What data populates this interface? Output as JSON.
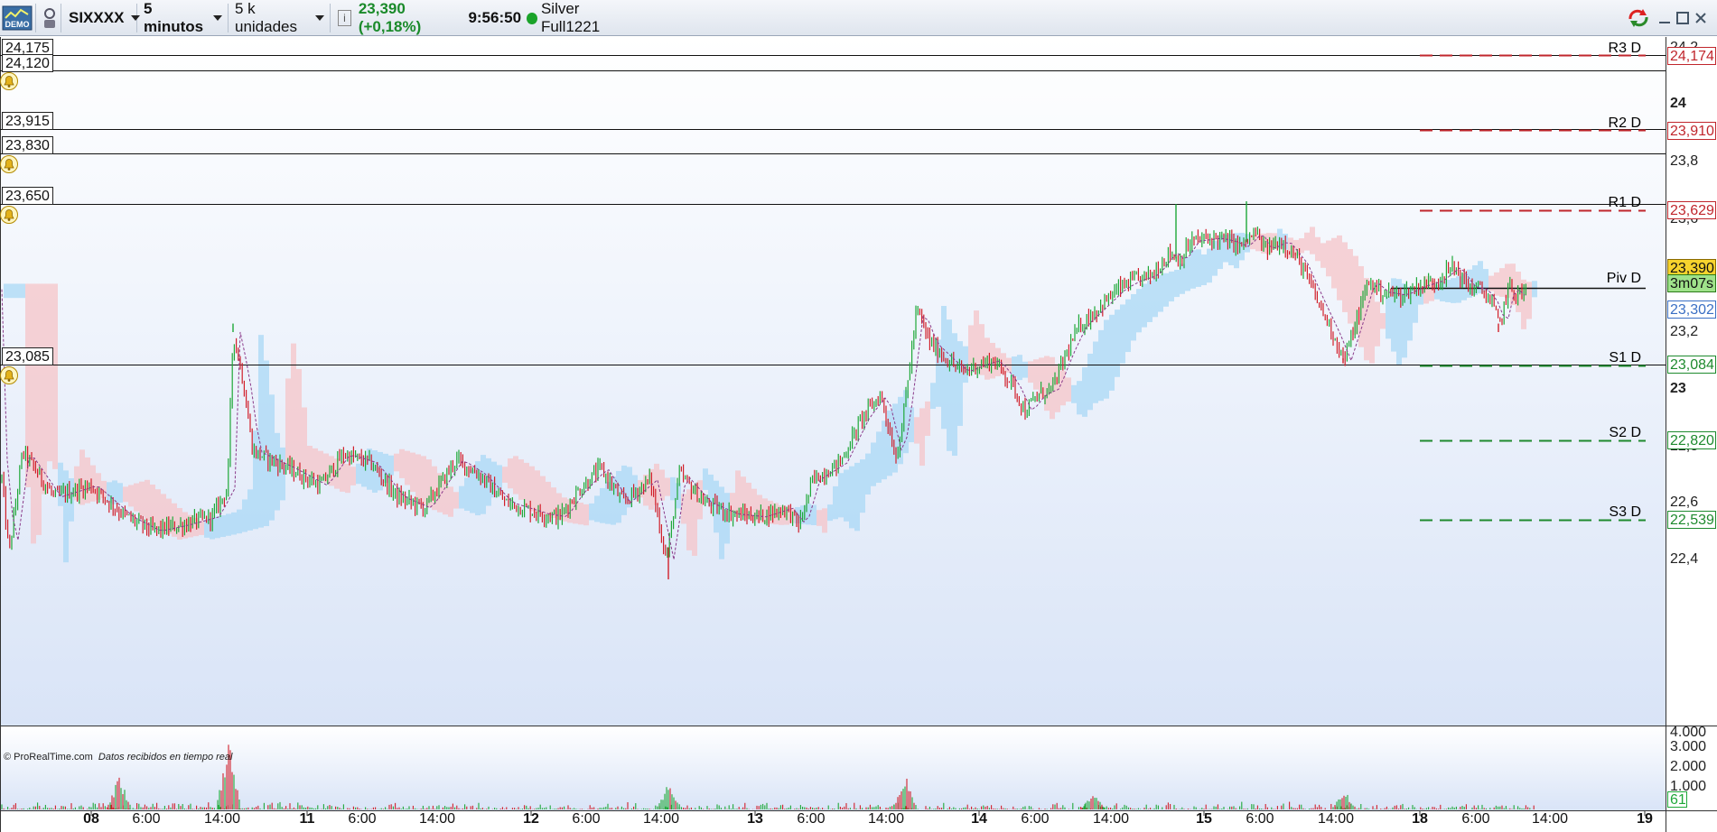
{
  "toolbar": {
    "demo_badge": "DEMO",
    "symbol": "SIXXXX",
    "timeframe": "5 minutos",
    "units": "5 k unidades",
    "quote": "23,390 (+0,18%)",
    "time": "9:56:50",
    "account": "Silver Full1221"
  },
  "alerts": [
    {
      "label": "24,175"
    },
    {
      "label": "24,120"
    },
    {
      "label": "23,915"
    },
    {
      "label": "23,830"
    },
    {
      "label": "23,650"
    },
    {
      "label": "23,085"
    }
  ],
  "pivots": [
    {
      "name": "R3 D",
      "value": "24,174",
      "color": "#c0262c"
    },
    {
      "name": "R2 D",
      "value": "23,910",
      "color": "#c0262c"
    },
    {
      "name": "R1 D",
      "value": "23,629",
      "color": "#c0262c"
    },
    {
      "name": "Piv D",
      "value": "3m07s",
      "color": "#111111"
    },
    {
      "name": "S1 D",
      "value": "23,084",
      "color": "#1e8a2e"
    },
    {
      "name": "S2 D",
      "value": "22,820",
      "color": "#1e8a2e"
    },
    {
      "name": "S3 D",
      "value": "22,539",
      "color": "#1e8a2e"
    }
  ],
  "price_tags": {
    "last": "23,390",
    "countdown": "3m07s",
    "ref": "23,302",
    "volume_last": "61"
  },
  "y_axis": [
    "24,2",
    "24",
    "23,8",
    "23,6",
    "23,2",
    "23",
    "22,8",
    "22,6",
    "22,4"
  ],
  "vol_axis": [
    "4.000",
    "3.000",
    "2.000",
    "1.000"
  ],
  "x_axis": [
    {
      "label": "08",
      "bold": true
    },
    {
      "label": "6:00",
      "bold": false
    },
    {
      "label": "14:00",
      "bold": false
    },
    {
      "label": "11",
      "bold": true
    },
    {
      "label": "6:00",
      "bold": false
    },
    {
      "label": "14:00",
      "bold": false
    },
    {
      "label": "12",
      "bold": true
    },
    {
      "label": "6:00",
      "bold": false
    },
    {
      "label": "14:00",
      "bold": false
    },
    {
      "label": "13",
      "bold": true
    },
    {
      "label": "6:00",
      "bold": false
    },
    {
      "label": "14:00",
      "bold": false
    },
    {
      "label": "14",
      "bold": true
    },
    {
      "label": "6:00",
      "bold": false
    },
    {
      "label": "14:00",
      "bold": false
    },
    {
      "label": "15",
      "bold": true
    },
    {
      "label": "6:00",
      "bold": false
    },
    {
      "label": "14:00",
      "bold": false
    },
    {
      "label": "18",
      "bold": true
    },
    {
      "label": "6:00",
      "bold": false
    },
    {
      "label": "14:00",
      "bold": false
    },
    {
      "label": "19",
      "bold": true
    }
  ],
  "footer": {
    "copyright": "© ProRealTime.com",
    "realtime": "Datos recibidos en tiempo real"
  },
  "colors": {
    "up": "#1ea838",
    "down": "#d11f2a",
    "cloud_up": "#a9d8f5",
    "cloud_down": "#f6c4c8",
    "bg_top": "#ffffff",
    "bg_bottom": "#d9e4f7"
  },
  "chart_data": {
    "type": "line",
    "ylim": [
      22.3,
      24.22
    ],
    "key_path": [
      [
        0,
        22.75
      ],
      [
        10,
        22.42
      ],
      [
        25,
        22.78
      ],
      [
        60,
        22.62
      ],
      [
        100,
        22.66
      ],
      [
        140,
        22.55
      ],
      [
        170,
        22.5
      ],
      [
        200,
        22.52
      ],
      [
        235,
        22.55
      ],
      [
        252,
        22.65
      ],
      [
        258,
        23.2
      ],
      [
        268,
        23.05
      ],
      [
        280,
        22.78
      ],
      [
        320,
        22.72
      ],
      [
        355,
        22.66
      ],
      [
        380,
        22.77
      ],
      [
        410,
        22.74
      ],
      [
        440,
        22.62
      ],
      [
        470,
        22.58
      ],
      [
        505,
        22.75
      ],
      [
        530,
        22.7
      ],
      [
        560,
        22.6
      ],
      [
        600,
        22.56
      ],
      [
        620,
        22.55
      ],
      [
        640,
        22.64
      ],
      [
        665,
        22.72
      ],
      [
        690,
        22.6
      ],
      [
        720,
        22.68
      ],
      [
        738,
        22.4
      ],
      [
        752,
        22.7
      ],
      [
        780,
        22.6
      ],
      [
        810,
        22.56
      ],
      [
        840,
        22.55
      ],
      [
        870,
        22.58
      ],
      [
        885,
        22.52
      ],
      [
        900,
        22.68
      ],
      [
        930,
        22.74
      ],
      [
        955,
        22.9
      ],
      [
        975,
        22.98
      ],
      [
        992,
        22.76
      ],
      [
        1000,
        22.9
      ],
      [
        1015,
        23.28
      ],
      [
        1030,
        23.16
      ],
      [
        1050,
        23.1
      ],
      [
        1065,
        23.06
      ],
      [
        1080,
        23.08
      ],
      [
        1100,
        23.1
      ],
      [
        1120,
        23.02
      ],
      [
        1135,
        22.92
      ],
      [
        1150,
        22.98
      ],
      [
        1165,
        23.0
      ],
      [
        1180,
        23.12
      ],
      [
        1195,
        23.22
      ],
      [
        1215,
        23.28
      ],
      [
        1238,
        23.35
      ],
      [
        1255,
        23.38
      ],
      [
        1275,
        23.4
      ],
      [
        1295,
        23.48
      ],
      [
        1305,
        23.45
      ],
      [
        1320,
        23.52
      ],
      [
        1345,
        23.53
      ],
      [
        1360,
        23.52
      ],
      [
        1375,
        23.5
      ],
      [
        1390,
        23.55
      ],
      [
        1400,
        23.49
      ],
      [
        1420,
        23.52
      ],
      [
        1440,
        23.44
      ],
      [
        1460,
        23.3
      ],
      [
        1475,
        23.2
      ],
      [
        1488,
        23.1
      ],
      [
        1500,
        23.22
      ],
      [
        1515,
        23.38
      ],
      [
        1530,
        23.34
      ],
      [
        1550,
        23.33
      ],
      [
        1570,
        23.36
      ],
      [
        1590,
        23.38
      ],
      [
        1610,
        23.43
      ],
      [
        1625,
        23.36
      ],
      [
        1640,
        23.35
      ],
      [
        1652,
        23.3
      ],
      [
        1660,
        23.22
      ],
      [
        1670,
        23.36
      ],
      [
        1680,
        23.33
      ],
      [
        1690,
        23.35
      ]
    ],
    "spikes": [
      {
        "x": 258,
        "high": 23.23
      },
      {
        "x": 740,
        "low": 22.33
      },
      {
        "x": 1302,
        "high": 23.65
      },
      {
        "x": 1380,
        "high": 23.66
      },
      {
        "x": 1487,
        "low": 23.09
      },
      {
        "x": 1659,
        "low": 23.2
      }
    ],
    "volume_spikes": [
      {
        "x": 253,
        "v": 3700
      },
      {
        "x": 132,
        "v": 1800
      },
      {
        "x": 1002,
        "v": 1900
      },
      {
        "x": 740,
        "v": 1400
      },
      {
        "x": 1488,
        "v": 1100
      },
      {
        "x": 1210,
        "v": 900
      }
    ]
  }
}
